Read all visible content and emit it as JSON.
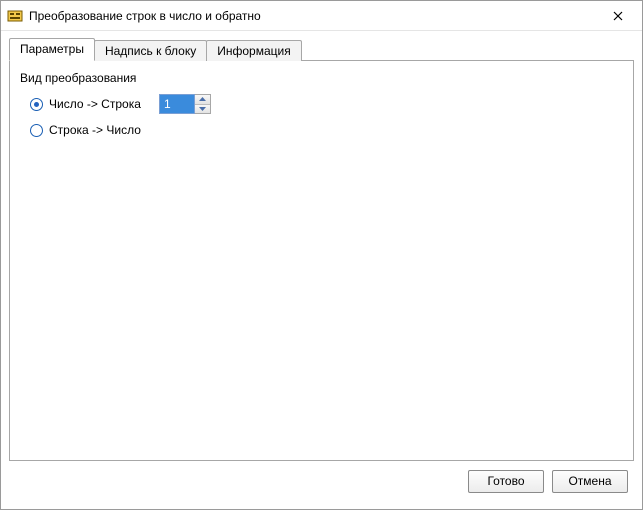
{
  "window": {
    "title": "Преобразование строк в число и обратно"
  },
  "tabs": [
    {
      "label": "Параметры",
      "active": true
    },
    {
      "label": "Надпись к блоку",
      "active": false
    },
    {
      "label": "Информация",
      "active": false
    }
  ],
  "parameters": {
    "section_label": "Вид преобразования",
    "option1": {
      "label": "Число -> Строка",
      "checked": true
    },
    "option2": {
      "label": "Строка -> Число",
      "checked": false
    },
    "spinner_value": "1"
  },
  "buttons": {
    "ok": "Готово",
    "cancel": "Отмена"
  }
}
